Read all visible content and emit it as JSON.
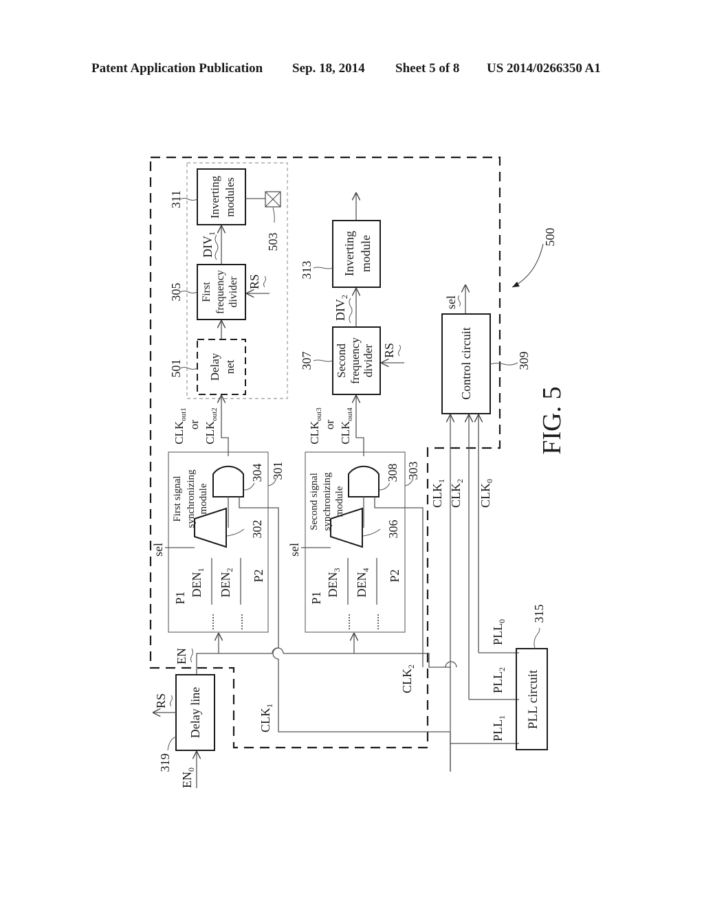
{
  "header": {
    "publication": "Patent Application Publication",
    "date": "Sep. 18, 2014",
    "sheet": "Sheet 5 of 8",
    "number": "US 2014/0266350 A1"
  },
  "figure": {
    "caption": "FIG. 5",
    "system_ref": "500",
    "blocks": {
      "inverting_modules": {
        "ref": "311",
        "line1": "Inverting",
        "line2": "modules"
      },
      "first_divider": {
        "ref": "305",
        "line1": "First",
        "line2": "frequency",
        "line3": "divider"
      },
      "delay_net": {
        "ref": "501",
        "line1": "Delay",
        "line2": "net"
      },
      "pad": {
        "ref": "503"
      },
      "inverting_module": {
        "ref": "313",
        "line1": "Inverting",
        "line2": "module"
      },
      "second_divider": {
        "ref": "307",
        "line1": "Second",
        "line2": "frequency",
        "line3": "divider"
      },
      "control_circuit": {
        "ref": "309",
        "label": "Control circuit"
      },
      "first_sync": {
        "ref": "301",
        "line1": "First signal",
        "line2": "synchronizing",
        "line3": "module",
        "mux_ref": "302",
        "gate_ref": "304"
      },
      "second_sync": {
        "ref": "303",
        "line1": "Second signal",
        "line2": "synchronizing",
        "line3": "module",
        "mux_ref": "306",
        "gate_ref": "308"
      },
      "delay_line": {
        "ref": "319",
        "label": "Delay line"
      },
      "pll_circuit": {
        "ref": "315",
        "label": "PLL circuit"
      }
    },
    "signals": {
      "div1": "DIV",
      "div1_sub": "1",
      "div2": "DIV",
      "div2_sub": "2",
      "rs": "RS",
      "sel": "sel",
      "clkout_a": "CLK",
      "clkout_a_sub": "out1",
      "or": "or",
      "clkout_b_sub": "out2",
      "clkout_c_sub": "out3",
      "clkout_d_sub": "out4",
      "den": "DEN",
      "den1": "1",
      "den2": "2",
      "den3": "3",
      "den4": "4",
      "p1": "P1",
      "p2": "P2",
      "dots": "......",
      "en": "EN",
      "en0": "EN",
      "en0_sub": "0",
      "clk": "CLK",
      "clk0": "0",
      "clk1": "1",
      "clk2": "2",
      "pll": "PLL",
      "pll0": "0",
      "pll1": "1",
      "pll2": "2"
    }
  }
}
